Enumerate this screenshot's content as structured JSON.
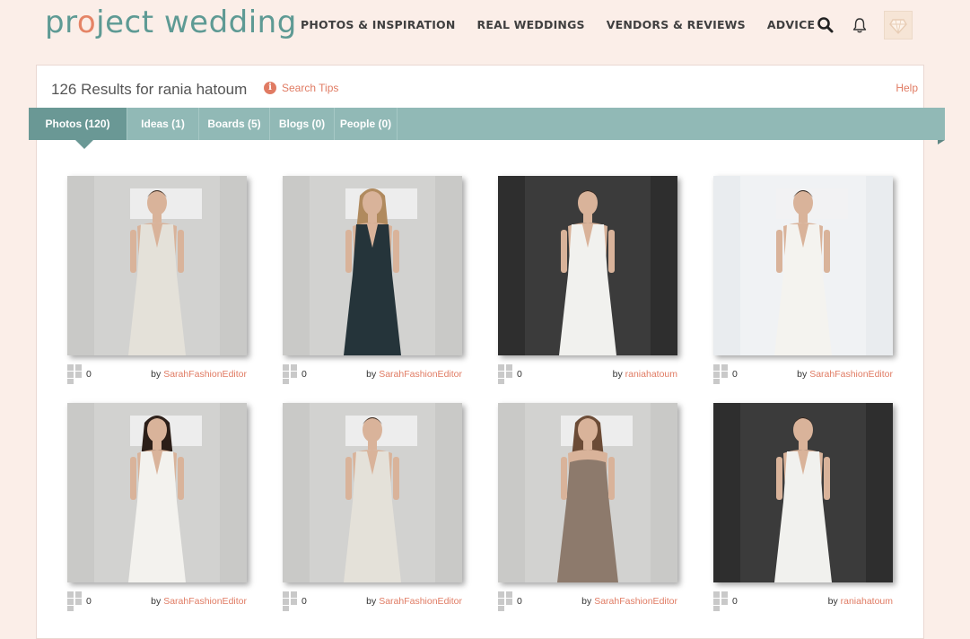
{
  "header": {
    "logo_pre": "pr",
    "logo_ring": "o",
    "logo_post": "ject wedding",
    "nav": [
      {
        "label": "PHOTOS & INSPIRATION"
      },
      {
        "label": "REAL WEDDINGS"
      },
      {
        "label": "VENDORS & REVIEWS"
      },
      {
        "label": "ADVICE"
      }
    ],
    "icons": [
      "search-icon",
      "bell-icon",
      "avatar"
    ]
  },
  "results": {
    "title": "126 Results for rania hatoum",
    "tips_label": "Search Tips",
    "help_label": "Help"
  },
  "tabs": [
    {
      "label": "Photos (120)",
      "active": true
    },
    {
      "label": "Ideas (1)",
      "active": false
    },
    {
      "label": "Boards (5)",
      "active": false
    },
    {
      "label": "Blogs (0)",
      "active": false
    },
    {
      "label": "People (0)",
      "active": false
    }
  ],
  "photos": [
    {
      "count": "0",
      "by": "by",
      "author": "SarahFashionEditor",
      "dress": "ivory-fitted",
      "bg": "light"
    },
    {
      "count": "0",
      "by": "by",
      "author": "SarahFashionEditor",
      "dress": "navy-long",
      "bg": "light"
    },
    {
      "count": "0",
      "by": "by",
      "author": "raniahatoum",
      "dress": "white-draped",
      "bg": "dark"
    },
    {
      "count": "0",
      "by": "by",
      "author": "SarahFashionEditor",
      "dress": "white-sleek",
      "bg": "bright"
    },
    {
      "count": "0",
      "by": "by",
      "author": "SarahFashionEditor",
      "dress": "white-vneck",
      "bg": "light"
    },
    {
      "count": "0",
      "by": "by",
      "author": "SarahFashionEditor",
      "dress": "ivory-fitted",
      "bg": "light"
    },
    {
      "count": "0",
      "by": "by",
      "author": "SarahFashionEditor",
      "dress": "taupe-strapless",
      "bg": "light"
    },
    {
      "count": "0",
      "by": "by",
      "author": "raniahatoum",
      "dress": "white-draped",
      "bg": "dark"
    }
  ],
  "colors": {
    "brand": "#5e9a94",
    "accent": "#e07b63",
    "tab_bar": "#91b9b6",
    "tab_active": "#6a9895",
    "page_bg": "#fbeee8"
  }
}
